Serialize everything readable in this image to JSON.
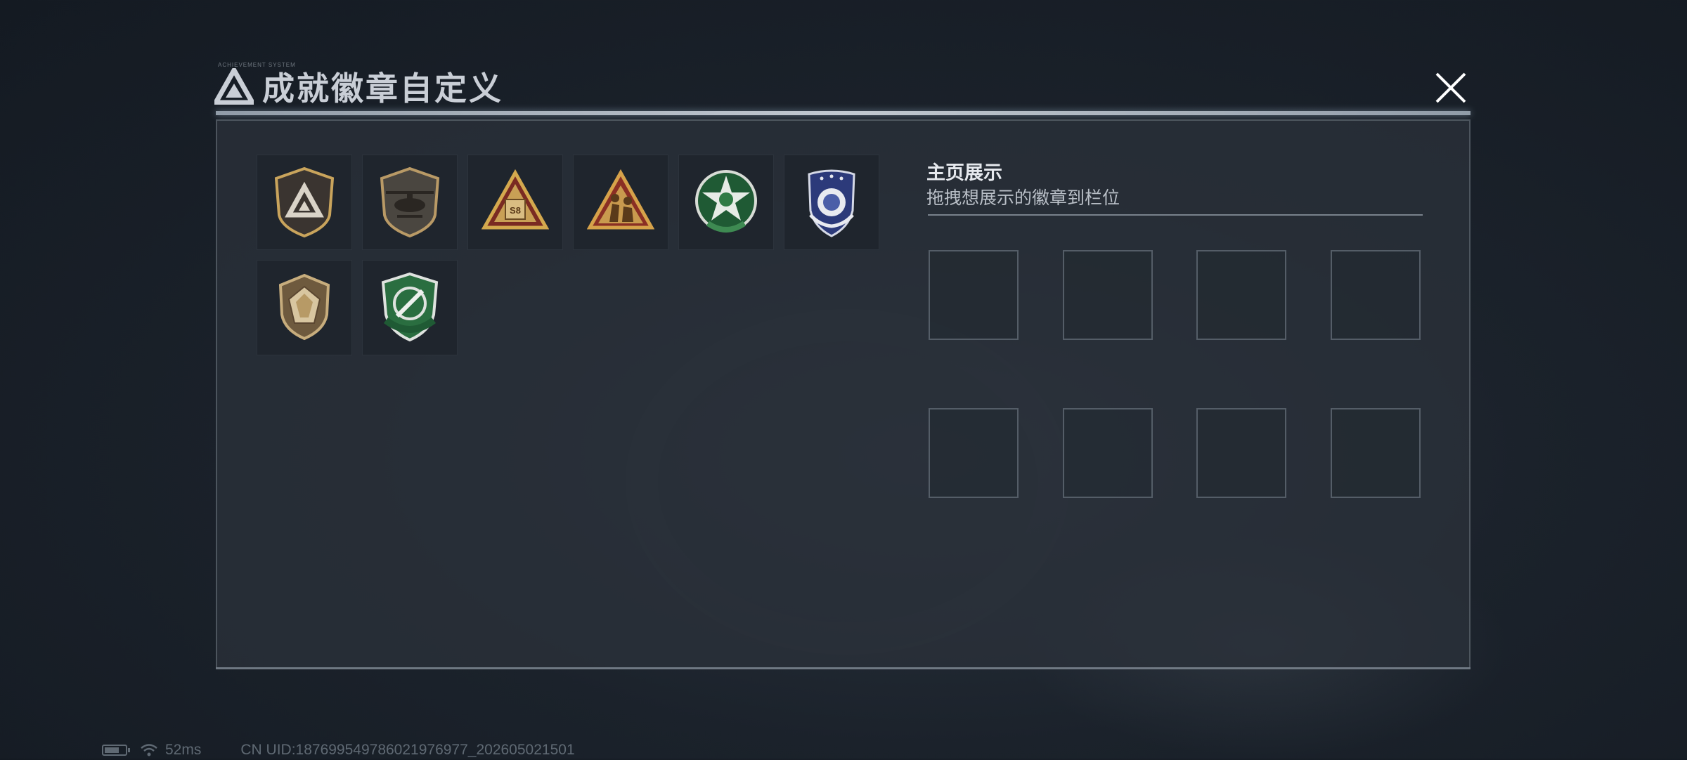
{
  "header": {
    "title": "成就徽章自定义",
    "caption": "ACHIEVEMENT SYSTEM",
    "logo_icon": "triangle-logo-icon",
    "close_icon": "close-icon"
  },
  "badges": [
    {
      "icon": "triangle-shield-badge-icon",
      "color": "#c9a45c"
    },
    {
      "icon": "helicopter-shield-badge-icon",
      "color": "#b99a66"
    },
    {
      "icon": "s8-triangle-badge-icon",
      "color": "#d4a94e"
    },
    {
      "icon": "soldiers-triangle-badge-icon",
      "color": "#d6a24a"
    },
    {
      "icon": "green-star-badge-icon",
      "color": "#3e8a52"
    },
    {
      "icon": "blue-wing-badge-icon",
      "color": "#4b5ea8"
    },
    {
      "icon": "gem-shield-badge-icon",
      "color": "#c7ad7d"
    },
    {
      "icon": "green-sword-shield-badge-icon",
      "color": "#2f7a45"
    }
  ],
  "showcase": {
    "title": "主页展示",
    "subtitle": "拖拽想展示的徽章到栏位",
    "slots": [
      {
        "id": 1
      },
      {
        "id": 2
      },
      {
        "id": 3
      },
      {
        "id": 4
      },
      {
        "id": 5
      },
      {
        "id": 6
      },
      {
        "id": 7
      },
      {
        "id": 8
      }
    ]
  },
  "status": {
    "ping": "52ms",
    "uid": "CN UID:18769954978602197697​7_202605021501",
    "battery_level": 0.7
  }
}
